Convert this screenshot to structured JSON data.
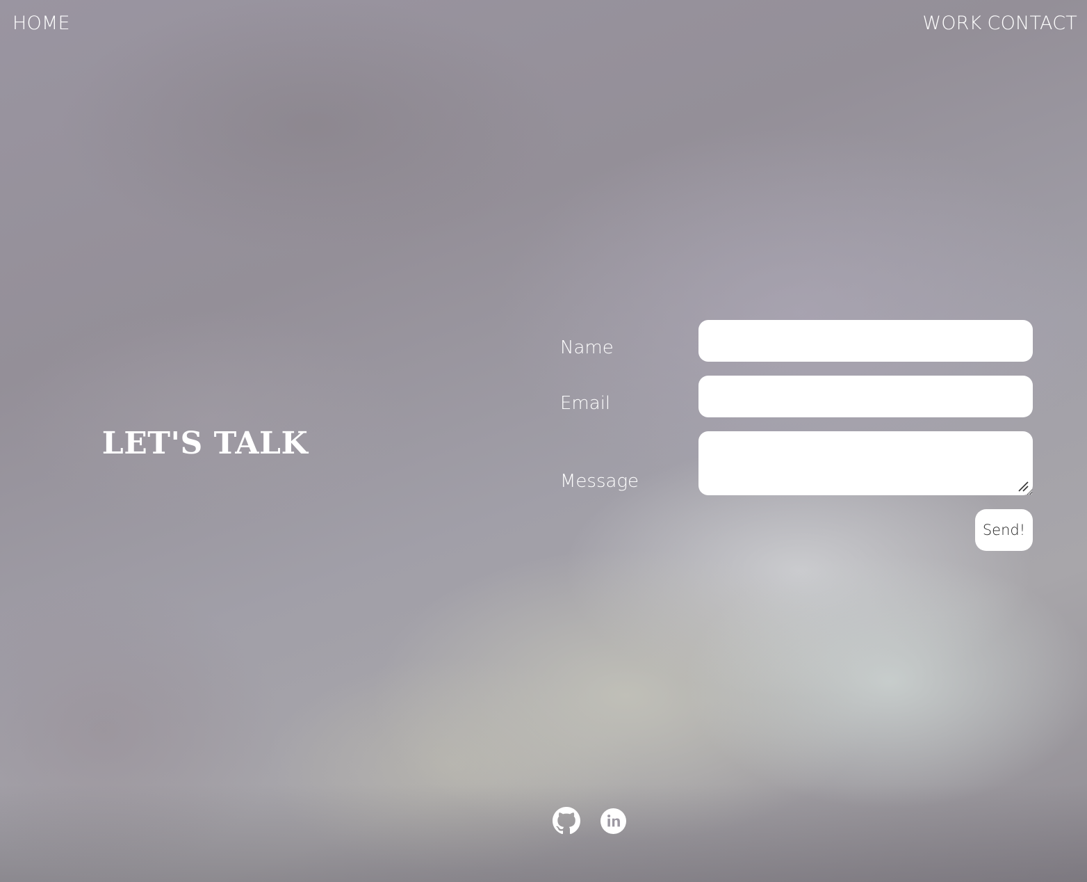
{
  "nav": {
    "home_label": "HOME",
    "work_label": "WORK",
    "contact_label": "CONTACT"
  },
  "hero": {
    "title": "LET'S TALK"
  },
  "form": {
    "name_label": "Name",
    "name_value": "",
    "email_label": "Email",
    "email_value": "",
    "message_label": "Message",
    "message_value": "",
    "send_label": "Send!"
  },
  "social": {
    "links": [
      {
        "icon": "github-icon"
      },
      {
        "icon": "linkedin-icon"
      }
    ]
  },
  "colors": {
    "text": "#ffffff",
    "field_background": "#ffffff",
    "button_text": "#222222"
  }
}
